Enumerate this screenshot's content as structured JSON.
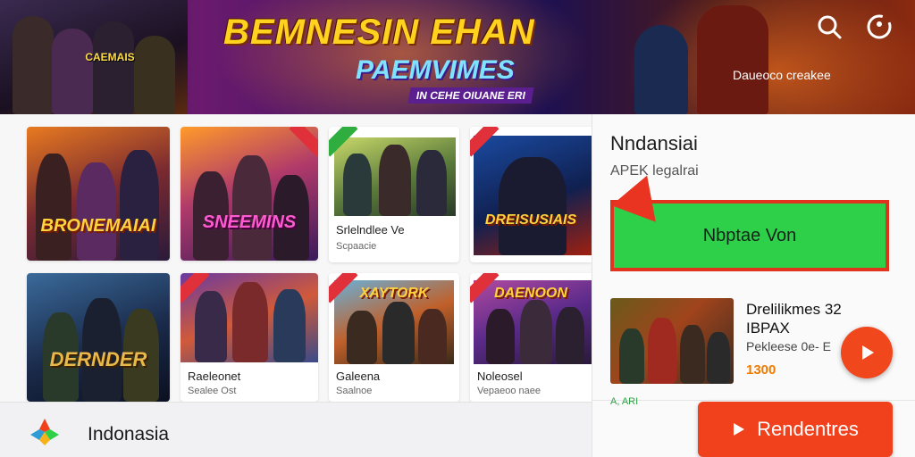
{
  "banner": {
    "title": "BEMNESIN EHAN",
    "subtitle": "PAEMVIMES",
    "tagline": "IN CEHE OIUANE ERI",
    "left_badge": "CAEMAIS",
    "right_text": "Daueoco creakee"
  },
  "header_icons": {
    "search": "search-icon",
    "account": "account-icon"
  },
  "grid": {
    "cards": [
      {
        "art_title": "BRONEMAIAI",
        "name": "",
        "meta": ""
      },
      {
        "art_title": "SNEEMINS",
        "name": "",
        "meta": ""
      },
      {
        "art_title": "",
        "name": "Srlelndlee Ve",
        "meta": "Scpaacie"
      },
      {
        "art_title": "DREISUSIAIS",
        "name": "",
        "meta": ""
      },
      {
        "art_title": "DERNDER",
        "name": "",
        "meta": ""
      },
      {
        "art_title": "",
        "name": "Raeleonet",
        "meta": "Sealee Ost"
      },
      {
        "art_title": "XAYTORK",
        "name": "Galeena",
        "meta": "Saalnoe"
      },
      {
        "art_title": "DAENOON",
        "name": "Noleosel",
        "meta": "Vepaeoo naee"
      }
    ]
  },
  "panel": {
    "title": "Nndansiai",
    "subtitle": "APEK legalrai",
    "install_label": "Nbptae Von",
    "featured": {
      "title_line1": "Drelilikmes 32",
      "title_line2": "IBPAX",
      "meta": "Pekleese 0e- E",
      "price": "1300"
    },
    "small_text": "A, ARI",
    "cta_label": "Rendentres"
  },
  "bottom": {
    "brand": "Indonasia"
  },
  "colors": {
    "accent_orange": "#f0401c",
    "install_green": "#2ed04a",
    "highlight_red": "#e0341f",
    "title_gold": "#ffd21f"
  }
}
